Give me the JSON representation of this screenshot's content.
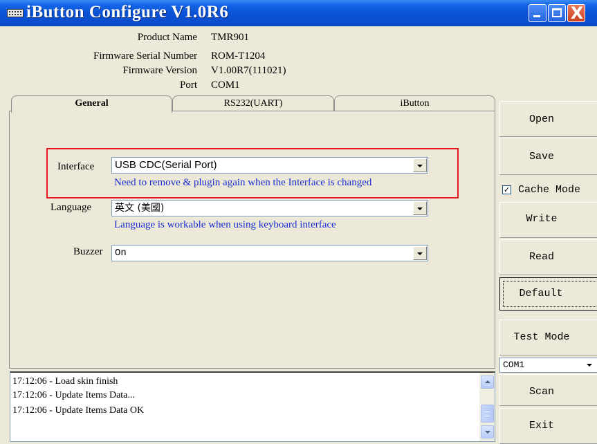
{
  "window": {
    "title": "iButton Configure V1.0R6",
    "controls": {
      "minimize": "minimize",
      "maximize": "maximize",
      "close": "X"
    }
  },
  "info": {
    "product_name_label": "Product Name",
    "product_name_value": "TMR901",
    "serial_label": "Firmware Serial Number",
    "serial_value": "ROM-T1204",
    "version_label": "Firmware Version",
    "version_value": "V1.00R7(111021)",
    "port_label": "Port",
    "port_value": "COM1"
  },
  "tabs": [
    {
      "label": "General",
      "active": true
    },
    {
      "label": "RS232(UART)",
      "active": false
    },
    {
      "label": "iButton",
      "active": false
    }
  ],
  "general": {
    "interface_label": "Interface",
    "interface_value": "USB CDC(Serial Port)",
    "interface_hint": "Need to remove & plugin again when the Interface is changed",
    "language_label": "Language",
    "language_value": "英文 (美國)",
    "language_hint": "Language is workable when using keyboard interface",
    "buzzer_label": "Buzzer",
    "buzzer_value": "On"
  },
  "side": {
    "open": "Open",
    "save": "Save",
    "cache_mode": "Cache Mode",
    "cache_checked_mark": "✓",
    "write": "Write",
    "read": "Read",
    "default": "Default",
    "test_mode": "Test Mode",
    "port_select": "COM1",
    "scan": "Scan",
    "exit": "Exit"
  },
  "log": [
    "17:12:06 - Load skin finish",
    "17:12:06 - Update Items Data...",
    "17:12:06 - Update Items Data OK"
  ],
  "colors": {
    "titlebar": "#0a52d6",
    "highlight": "#e41a1c",
    "hint_text": "#1a2ccf",
    "window_bg": "#ece9d8"
  }
}
